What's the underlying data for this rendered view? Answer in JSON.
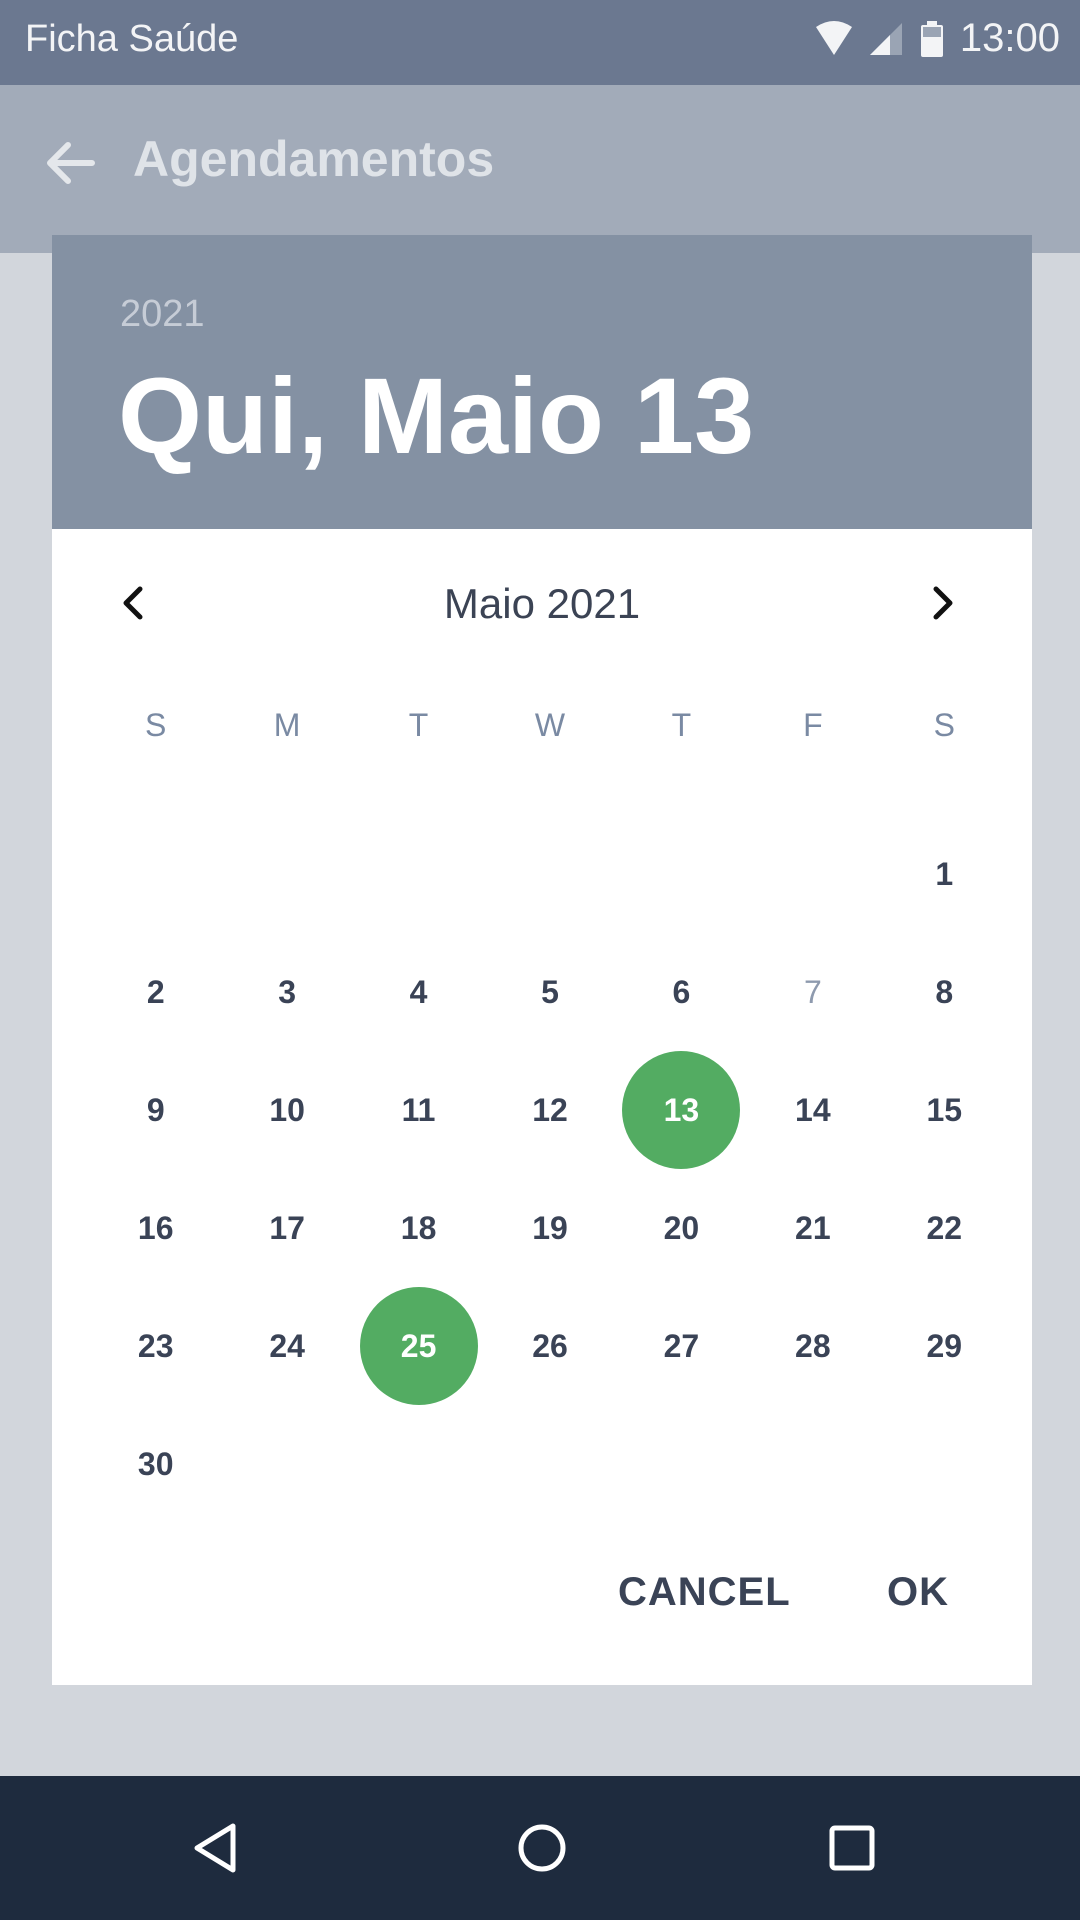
{
  "status_bar": {
    "app_name": "Ficha Saúde",
    "time": "13:00"
  },
  "app_bar": {
    "title": "Agendamentos",
    "back_icon": "arrow-left-icon"
  },
  "dialog": {
    "year": "2021",
    "selected_date": "Qui, Maio 13",
    "month_label": "Maio 2021",
    "weekdays": [
      "S",
      "M",
      "T",
      "W",
      "T",
      "F",
      "S"
    ],
    "weeks": [
      [
        "",
        "",
        "",
        "",
        "",
        "",
        "1"
      ],
      [
        "2",
        "3",
        "4",
        "5",
        "6",
        "7",
        "8"
      ],
      [
        "9",
        "10",
        "11",
        "12",
        "13",
        "14",
        "15"
      ],
      [
        "16",
        "17",
        "18",
        "19",
        "20",
        "21",
        "22"
      ],
      [
        "23",
        "24",
        "25",
        "26",
        "27",
        "28",
        "29"
      ],
      [
        "30",
        "",
        "",
        "",
        "",
        "",
        ""
      ]
    ],
    "highlighted_days": [
      "13",
      "25"
    ],
    "muted_days": [
      "7"
    ],
    "highlight_color": "#53ac62",
    "cancel_label": "CANCEL",
    "ok_label": "OK"
  },
  "colors": {
    "status_bar": "#6b7890",
    "app_bar": "#a2abb9",
    "dialog_header": "#8491a3",
    "nav_bar": "#1e2b3e"
  }
}
